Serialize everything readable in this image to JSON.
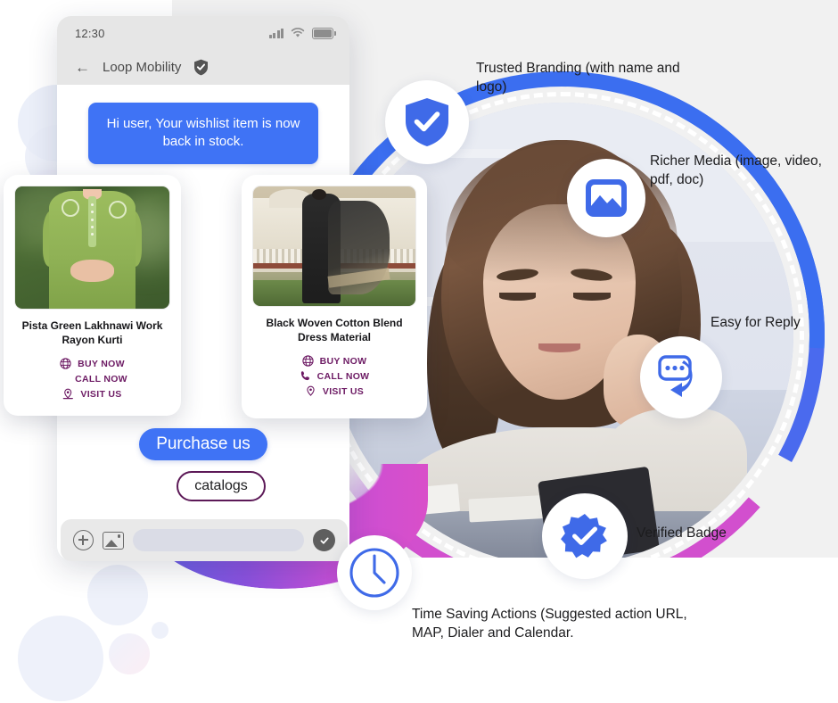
{
  "phone": {
    "status_time": "12:30",
    "status_icons": [
      "signal-icon",
      "wifi-icon",
      "battery-icon"
    ],
    "back_icon": "back-arrow-icon",
    "title": "Loop Mobility",
    "verified_icon": "shield-check-icon",
    "message": "Hi user, Your wishlist item is now back in stock."
  },
  "cards": [
    {
      "image": "pista-green-kurti-photo",
      "title": "Pista Green Lakhnawi Work Rayon Kurti",
      "actions": [
        {
          "icon": "globe-icon",
          "label": "BUY NOW"
        },
        {
          "icon": "none",
          "label": "CALL NOW"
        },
        {
          "icon": "map-pin-icon",
          "label": "VISIT US"
        }
      ]
    },
    {
      "image": "black-woven-dress-photo",
      "title": "Black Woven Cotton Blend Dress Material",
      "actions": [
        {
          "icon": "globe-icon",
          "label": "BUY NOW"
        },
        {
          "icon": "phone-icon",
          "label": "CALL NOW"
        },
        {
          "icon": "map-pin-icon",
          "label": "VISIT US"
        }
      ]
    }
  ],
  "chips": {
    "primary": "Purchase us",
    "outline": "catalogs"
  },
  "input_bar": {
    "attach_icon": "plus-circle-icon",
    "gallery_icon": "image-icon",
    "field_value": "",
    "field_placeholder": "",
    "send_icon": "check-circle-icon"
  },
  "features": [
    {
      "icon": "shield-check-icon",
      "label": "Trusted Branding (with name and logo)"
    },
    {
      "icon": "image-icon",
      "label": "Richer Media (image, video, pdf, doc)"
    },
    {
      "icon": "chat-reply-icon",
      "label": "Easy for Reply"
    },
    {
      "icon": "verified-badge-icon",
      "label": "Verified Badge"
    },
    {
      "icon": "clock-icon",
      "label": "Time Saving Actions (Suggested action URL, MAP, Dialer and Calendar."
    }
  ],
  "colors": {
    "accent_blue": "#3f73f5",
    "arc_blue": "#3b6ef0",
    "arc_purple": "#a64ad4",
    "arc_magenta": "#d24fce",
    "action_purple": "#6d1b64",
    "background_gray": "#f1f1f1"
  }
}
